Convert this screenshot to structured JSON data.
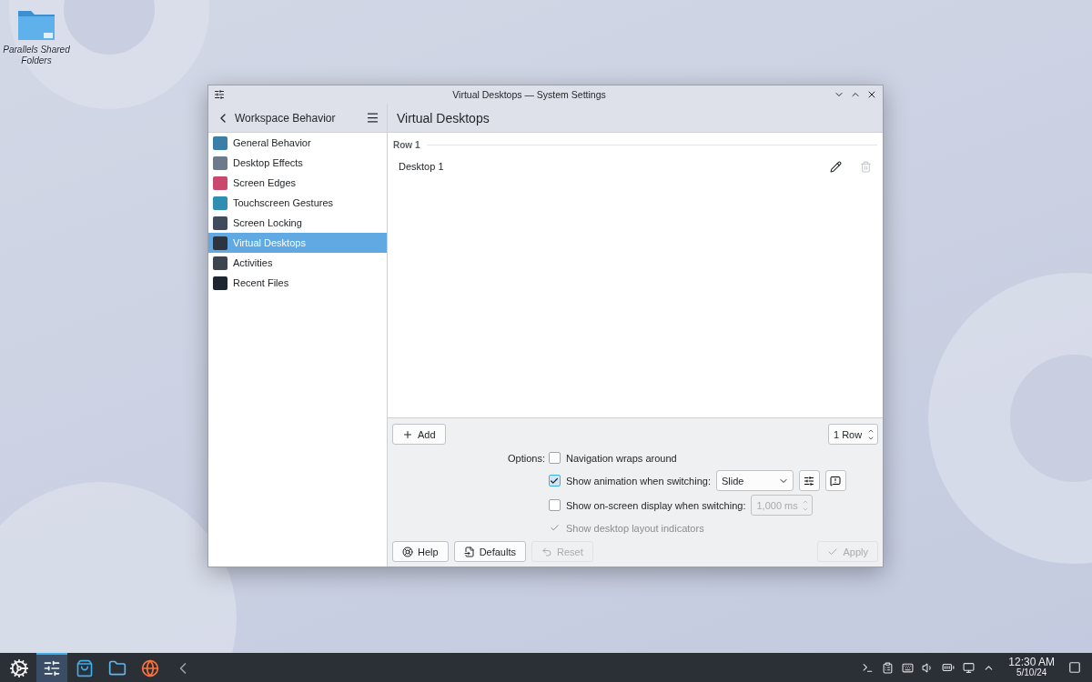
{
  "desktop_icons": [
    {
      "label": "Parallels Shared Folders"
    }
  ],
  "window": {
    "title": "Virtual Desktops — System Settings",
    "sidebar": {
      "back_label": "Workspace Behavior",
      "items": [
        {
          "label": "General Behavior",
          "selected": false
        },
        {
          "label": "Desktop Effects",
          "selected": false
        },
        {
          "label": "Screen Edges",
          "selected": false
        },
        {
          "label": "Touchscreen Gestures",
          "selected": false
        },
        {
          "label": "Screen Locking",
          "selected": false
        },
        {
          "label": "Virtual Desktops",
          "selected": true
        },
        {
          "label": "Activities",
          "selected": false
        },
        {
          "label": "Recent Files",
          "selected": false
        }
      ]
    },
    "page": {
      "title": "Virtual Desktops",
      "rows": [
        {
          "label": "Row 1",
          "desktops": [
            {
              "name": "Desktop 1"
            }
          ]
        }
      ],
      "add_button": "Add",
      "rows_spin": "1 Row",
      "options_label": "Options:",
      "options": [
        {
          "label": "Navigation wraps around",
          "checked": false,
          "disabled": false
        },
        {
          "label": "Show animation when switching:",
          "checked": true,
          "disabled": false,
          "control": {
            "kind": "combo",
            "value": "Slide"
          }
        },
        {
          "label": "Show on-screen display when switching:",
          "checked": false,
          "disabled": false,
          "control": {
            "kind": "spin",
            "value": "1,000 ms",
            "disabled": true
          }
        },
        {
          "label": "Show desktop layout indicators",
          "checked": true,
          "disabled": true
        }
      ],
      "buttons": [
        {
          "kind": "help",
          "label": "Help",
          "disabled": false
        },
        {
          "kind": "defaults",
          "label": "Defaults",
          "disabled": false
        },
        {
          "kind": "reset",
          "label": "Reset",
          "disabled": true
        },
        {
          "kind": "apply",
          "label": "Apply",
          "disabled": true
        }
      ]
    }
  },
  "taskbar": {
    "tasks": [
      {
        "selected": true
      },
      {
        "selected": false
      },
      {
        "selected": false
      },
      {
        "selected": false
      },
      {
        "selected": false
      }
    ],
    "clock": {
      "time": "12:30 AM",
      "date": "5/10/24"
    }
  }
}
